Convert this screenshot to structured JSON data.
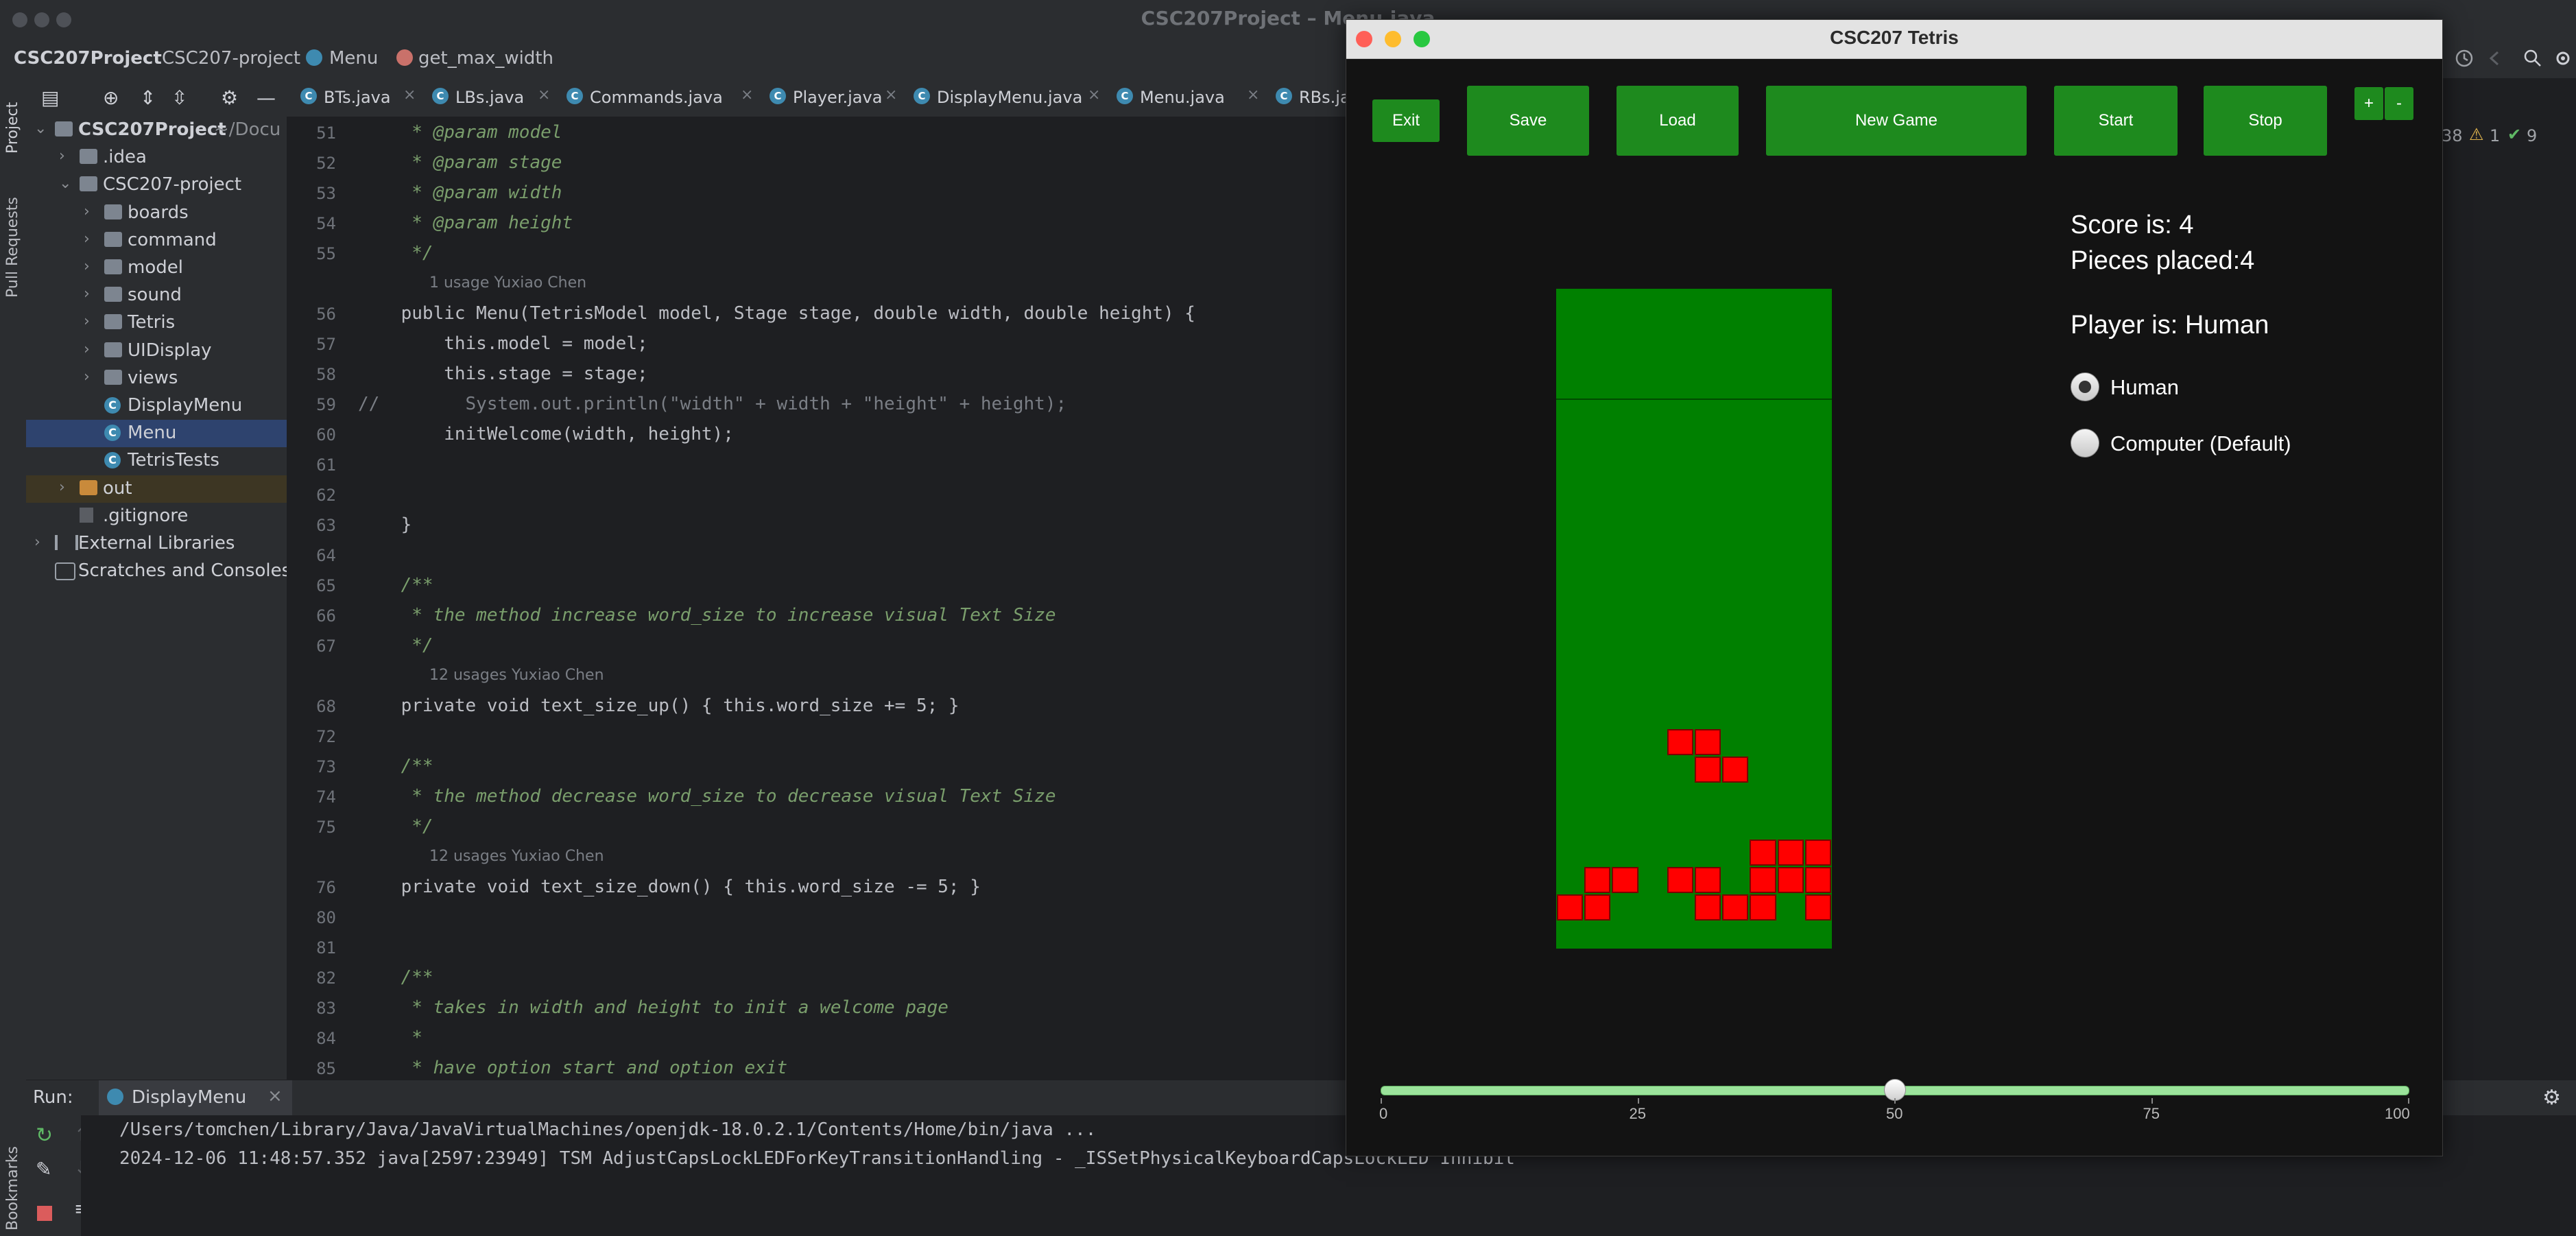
{
  "ide": {
    "window_title": "CSC207Project – Menu.java",
    "breadcrumb": [
      "CSC207Project",
      "CSC207-project",
      "Menu",
      "get_max_width"
    ],
    "side_tabs": [
      "Project",
      "Pull Requests",
      "Bookmarks"
    ],
    "status_counts": [
      "38",
      "1",
      "9"
    ]
  },
  "project_tree": [
    {
      "label": "CSC207Project",
      "suffix": "~/Docu",
      "type": "folder-root",
      "level": 0,
      "expanded": true
    },
    {
      "label": ".idea",
      "type": "folder",
      "level": 1,
      "expanded": false
    },
    {
      "label": "CSC207-project",
      "type": "folder",
      "level": 1,
      "expanded": true
    },
    {
      "label": "boards",
      "type": "folder",
      "level": 2,
      "expanded": false
    },
    {
      "label": "command",
      "type": "folder",
      "level": 2,
      "expanded": false
    },
    {
      "label": "model",
      "type": "folder",
      "level": 2,
      "expanded": false
    },
    {
      "label": "sound",
      "type": "folder",
      "level": 2,
      "expanded": false
    },
    {
      "label": "Tetris",
      "type": "folder",
      "level": 2,
      "expanded": false
    },
    {
      "label": "UIDisplay",
      "type": "folder",
      "level": 2,
      "expanded": false
    },
    {
      "label": "views",
      "type": "folder",
      "level": 2,
      "expanded": false
    },
    {
      "label": "DisplayMenu",
      "type": "class",
      "level": 2
    },
    {
      "label": "Menu",
      "type": "class",
      "level": 2,
      "selected": true
    },
    {
      "label": "TetrisTests",
      "type": "class",
      "level": 2
    },
    {
      "label": "out",
      "type": "folder-orange",
      "level": 1,
      "expanded": false
    },
    {
      "label": ".gitignore",
      "type": "file",
      "level": 1
    },
    {
      "label": "External Libraries",
      "type": "lib",
      "level": 0,
      "expanded": false
    },
    {
      "label": "Scratches and Consoles",
      "type": "scratch",
      "level": 0
    }
  ],
  "editor_tabs": [
    {
      "label": "BTs.java",
      "active": false
    },
    {
      "label": "LBs.java",
      "active": false
    },
    {
      "label": "Commands.java",
      "active": false
    },
    {
      "label": "Player.java",
      "active": false
    },
    {
      "label": "DisplayMenu.java",
      "active": false
    },
    {
      "label": "Menu.java",
      "active": true
    },
    {
      "label": "RBs.java",
      "active": false
    }
  ],
  "editor_lines": [
    {
      "n": "51",
      "text": "     * @param model",
      "kind": "comment"
    },
    {
      "n": "52",
      "text": "     * @param stage",
      "kind": "comment"
    },
    {
      "n": "53",
      "text": "     * @param width",
      "kind": "comment"
    },
    {
      "n": "54",
      "text": "     * @param height",
      "kind": "comment"
    },
    {
      "n": "55",
      "text": "     */",
      "kind": "comment"
    },
    {
      "n": "",
      "text": "1 usage   Yuxiao Chen",
      "kind": "hint"
    },
    {
      "n": "56",
      "text": "    public Menu(TetrisModel model, Stage stage, double width, double height) {",
      "kind": "code"
    },
    {
      "n": "57",
      "text": "        this.model = model;",
      "kind": "code"
    },
    {
      "n": "58",
      "text": "        this.stage = stage;",
      "kind": "code"
    },
    {
      "n": "59",
      "text": "//        System.out.println(\"width\" + width + \"height\" + height);",
      "kind": "linecomment"
    },
    {
      "n": "60",
      "text": "        initWelcome(width, height);",
      "kind": "code"
    },
    {
      "n": "61",
      "text": "",
      "kind": "code"
    },
    {
      "n": "62",
      "text": "",
      "kind": "code"
    },
    {
      "n": "63",
      "text": "    }",
      "kind": "code"
    },
    {
      "n": "64",
      "text": "",
      "kind": "code"
    },
    {
      "n": "65",
      "text": "    /**",
      "kind": "comment"
    },
    {
      "n": "66",
      "text": "     * the method increase word_size to increase visual Text Size",
      "kind": "comment"
    },
    {
      "n": "67",
      "text": "     */",
      "kind": "comment"
    },
    {
      "n": "",
      "text": "12 usages   Yuxiao Chen",
      "kind": "hint"
    },
    {
      "n": "68",
      "text": "    private void text_size_up() { this.word_size += 5; }",
      "kind": "code"
    },
    {
      "n": "72",
      "text": "",
      "kind": "code"
    },
    {
      "n": "73",
      "text": "    /**",
      "kind": "comment"
    },
    {
      "n": "74",
      "text": "     * the method decrease word_size to decrease visual Text Size",
      "kind": "comment"
    },
    {
      "n": "75",
      "text": "     */",
      "kind": "comment"
    },
    {
      "n": "",
      "text": "12 usages   Yuxiao Chen",
      "kind": "hint"
    },
    {
      "n": "76",
      "text": "    private void text_size_down() { this.word_size -= 5; }",
      "kind": "code"
    },
    {
      "n": "80",
      "text": "",
      "kind": "code"
    },
    {
      "n": "81",
      "text": "",
      "kind": "code"
    },
    {
      "n": "82",
      "text": "    /**",
      "kind": "comment"
    },
    {
      "n": "83",
      "text": "     * takes in width and height to init a welcome page",
      "kind": "comment"
    },
    {
      "n": "84",
      "text": "     *",
      "kind": "comment"
    },
    {
      "n": "85",
      "text": "     * have option start and option exit",
      "kind": "comment"
    }
  ],
  "run_panel": {
    "label": "Run:",
    "config": "DisplayMenu",
    "console": [
      {
        "text": "/Users/tomchen/Library/Java/JavaVirtualMachines/openjdk-18.0.2.1/Contents/Home/bin/java ...",
        "color": "#a9b7c6"
      },
      {
        "text": "2024-12-06 11:48:57.352 java[2597:23949] TSM AdjustCapsLockLEDForKeyTransitionHandling - _ISSetPhysicalKeyboardCapsLockLED Inhibit",
        "color": "#e06c5c"
      }
    ]
  },
  "tetris": {
    "title": "CSC207 Tetris",
    "buttons": {
      "exit": "Exit",
      "save": "Save",
      "load": "Load",
      "new_game": "New Game",
      "start": "Start",
      "stop": "Stop",
      "plus": "+",
      "minus": "-"
    },
    "score": "Score is: 4",
    "pieces": "Pieces placed:4",
    "player": "Player is: Human",
    "radio_options": [
      {
        "label": "Human",
        "selected": true
      },
      {
        "label": "Computer (Default)",
        "selected": false
      }
    ],
    "slider": {
      "value": 50,
      "min": 0,
      "max": 100,
      "tick_labels": [
        "0",
        "25",
        "50",
        "75",
        "100"
      ]
    },
    "board": {
      "columns": 10,
      "rows": 24,
      "filled_cells": [
        [
          4,
          16
        ],
        [
          5,
          16
        ],
        [
          5,
          17
        ],
        [
          6,
          17
        ],
        [
          7,
          20
        ],
        [
          8,
          20
        ],
        [
          9,
          20
        ],
        [
          1,
          21
        ],
        [
          2,
          21
        ],
        [
          4,
          21
        ],
        [
          5,
          21
        ],
        [
          7,
          21
        ],
        [
          8,
          21
        ],
        [
          9,
          21
        ],
        [
          0,
          22
        ],
        [
          1,
          22
        ],
        [
          5,
          22
        ],
        [
          6,
          22
        ],
        [
          7,
          22
        ],
        [
          9,
          22
        ]
      ]
    },
    "colors": {
      "board": "#008000",
      "block": "#ff0000",
      "button": "#1e8a1e",
      "background": "#131313"
    }
  }
}
